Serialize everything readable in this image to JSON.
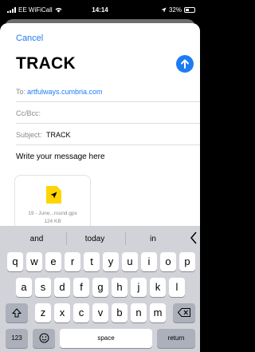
{
  "status_bar": {
    "carrier": "EE WiFiCall",
    "time": "14:14",
    "battery": "32%"
  },
  "compose": {
    "cancel_label": "Cancel",
    "title": "TRACK",
    "to_label": "To:",
    "to_value": "artfulways.cumbria.com",
    "cc_label": "Cc/Bcc:",
    "subject_label": "Subject:",
    "subject_value": "TRACK",
    "body_placeholder": "Write your message here",
    "attachment": {
      "filename": "19 - June...round.gpx",
      "size": "124 KB"
    }
  },
  "keyboard": {
    "suggestions": [
      "and",
      "today",
      "in"
    ],
    "row1": [
      "q",
      "w",
      "e",
      "r",
      "t",
      "y",
      "u",
      "i",
      "o",
      "p"
    ],
    "row2": [
      "a",
      "s",
      "d",
      "f",
      "g",
      "h",
      "j",
      "k",
      "l"
    ],
    "row3": [
      "z",
      "x",
      "c",
      "v",
      "b",
      "n",
      "m"
    ],
    "numbers_label": "123",
    "space_label": "space",
    "return_label": "return"
  },
  "colors": {
    "accent": "#1e7cf2",
    "attachment_icon": "#ffd400",
    "keyboard_bg": "#d1d3d9"
  }
}
